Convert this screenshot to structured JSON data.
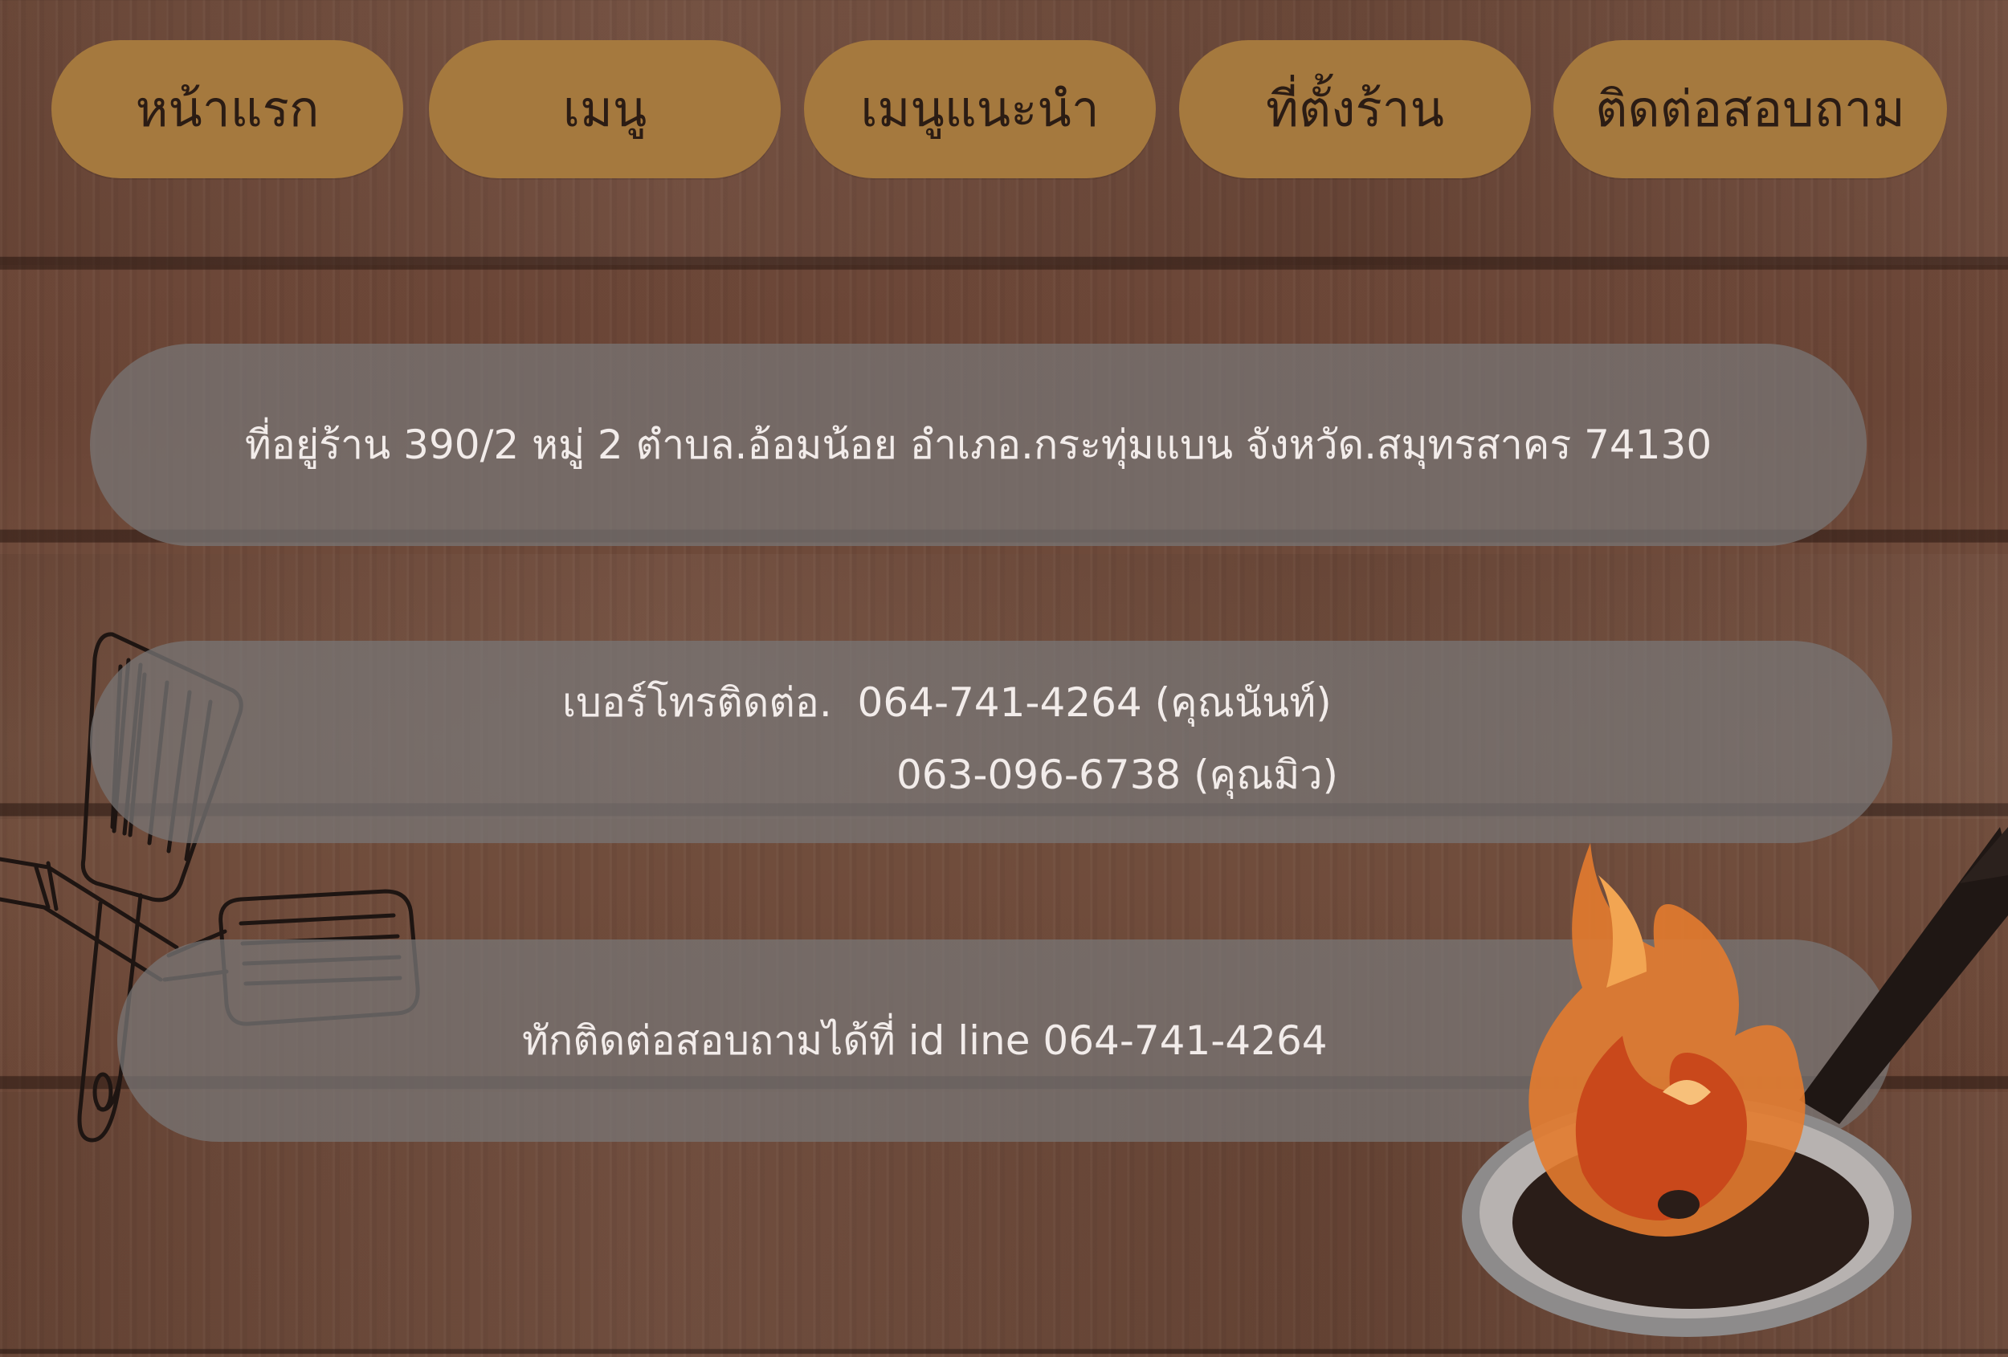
{
  "nav": {
    "items": [
      {
        "label": "หน้าแรก"
      },
      {
        "label": "เมนู"
      },
      {
        "label": "เมนูแนะนำ"
      },
      {
        "label": "ที่ตั้งร้าน"
      },
      {
        "label": "ติดต่อสอบถาม"
      }
    ]
  },
  "contact": {
    "address": "ที่อยู่ร้าน 390/2 หมู่ 2 ตำบล.อ้อมน้อย อำเภอ.กระทุ่มแบน จังหวัด.สมุทรสาคร 74130",
    "phone_label": "เบอร์โทรติดต่อ.",
    "phone_1": "064-741-4264 (คุณนันท์)",
    "phone_2": "063-096-6738 (คุณมิว)",
    "line": "ทักติดต่อสอบถามได้ที่ id line 064-741-4264"
  },
  "colors": {
    "nav_button": "#a5793e",
    "info_box": "#7a7777",
    "background": "#6e4a3a"
  },
  "icons": [
    "spatula-icon",
    "frying-pan-fire-icon"
  ]
}
